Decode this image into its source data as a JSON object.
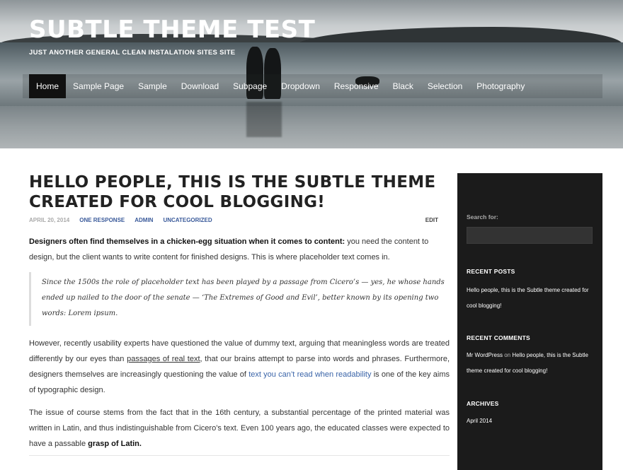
{
  "header": {
    "title": "SUBTLE THEME TEST",
    "tagline": "JUST ANOTHER GENERAL CLEAN INSTALATION SITES SITE"
  },
  "nav": {
    "items": [
      "Home",
      "Sample Page",
      "Sample",
      "Download",
      "Subpage",
      "Dropdown",
      "Responsive",
      "Black",
      "Selection",
      "Photography"
    ],
    "active": "Home"
  },
  "post": {
    "title": "HELLO PEOPLE, THIS IS THE SUBTLE THEME CREATED FOR COOL BLOGGING!",
    "date": "APRIL 20, 2014",
    "responses": "ONE RESPONSE",
    "author": "ADMIN",
    "category": "UNCATEGORIZED",
    "edit": "EDIT",
    "p1_bold": "Designers often find themselves in a chicken-egg situation when it comes to content:",
    "p1_rest": " you need the content to design, but the client wants to write content for finished designs. This is where placeholder text comes in.",
    "quote": "Since the 1500s the role of placeholder text has been played by a passage from Cicero’s — yes, he whose hands ended up nailed to the door of the senate — ‘The Extremes of Good and Evil’, better known by its opening two words: Lorem ipsum.",
    "p2_a": "However, recently usability experts have questioned the value of dummy text, arguing that meaningless words are treated differently by our eyes than ",
    "p2_link1": "passages of real text",
    "p2_b": ", that our brains attempt to parse into words and phrases. Furthermore, designers themselves are increasingly questioning the value of ",
    "p2_link2": "text you can’t read when readability",
    "p2_c": " is one of the key aims of typographic design.",
    "p3_a": "The issue of course stems from the fact that in the 16th century, a substantial percentage of the printed material was written in Latin, and thus indistinguishable from Cicero’s text. Even 100 years ago, the educated classes were expected to have a passable ",
    "p3_bold": "grasp of Latin."
  },
  "sidebar": {
    "search_label": "Search for:",
    "recent_posts_heading": "RECENT POSTS",
    "recent_post": "Hello people, this is the Subtle theme created for cool blogging!",
    "recent_comments_heading": "RECENT COMMENTS",
    "comment_author": "Mr WordPress",
    "comment_on": " on ",
    "comment_post": "Hello people, this is the Subtle theme created for cool blogging!",
    "archives_heading": "ARCHIVES",
    "archive_item": "April 2014"
  },
  "colors": {
    "sidebar_bg": "#1b1b1b",
    "link_blue": "#3a64a8",
    "nav_active_bg": "#111111"
  }
}
